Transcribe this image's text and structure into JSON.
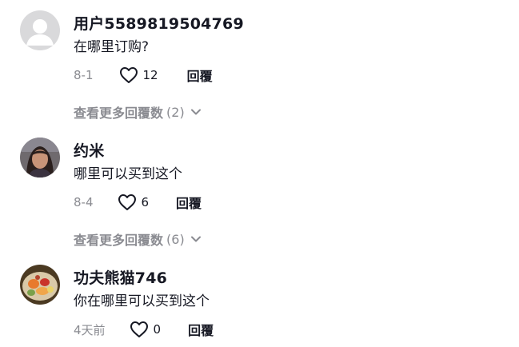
{
  "comments": [
    {
      "username": "用户5589819504769",
      "text": "在哪里订购?",
      "date": "8-1",
      "likes": "12",
      "reply_label": "回覆",
      "more_label": "查看更多回覆数",
      "more_count": "(2)",
      "avatar": "default-user-icon"
    },
    {
      "username": "约米",
      "text": "哪里可以买到这个",
      "date": "8-4",
      "likes": "6",
      "reply_label": "回覆",
      "more_label": "查看更多回覆数",
      "more_count": "(6)",
      "avatar": "profile-photo-woman"
    },
    {
      "username": "功夫熊猫746",
      "text": "你在哪里可以买到这个",
      "date": "4天前",
      "likes": "0",
      "reply_label": "回覆",
      "avatar": "profile-photo-food"
    }
  ],
  "colors": {
    "text": "#161823",
    "secondary": "#8a8b91",
    "avatar_placeholder": "#d9d9db"
  }
}
